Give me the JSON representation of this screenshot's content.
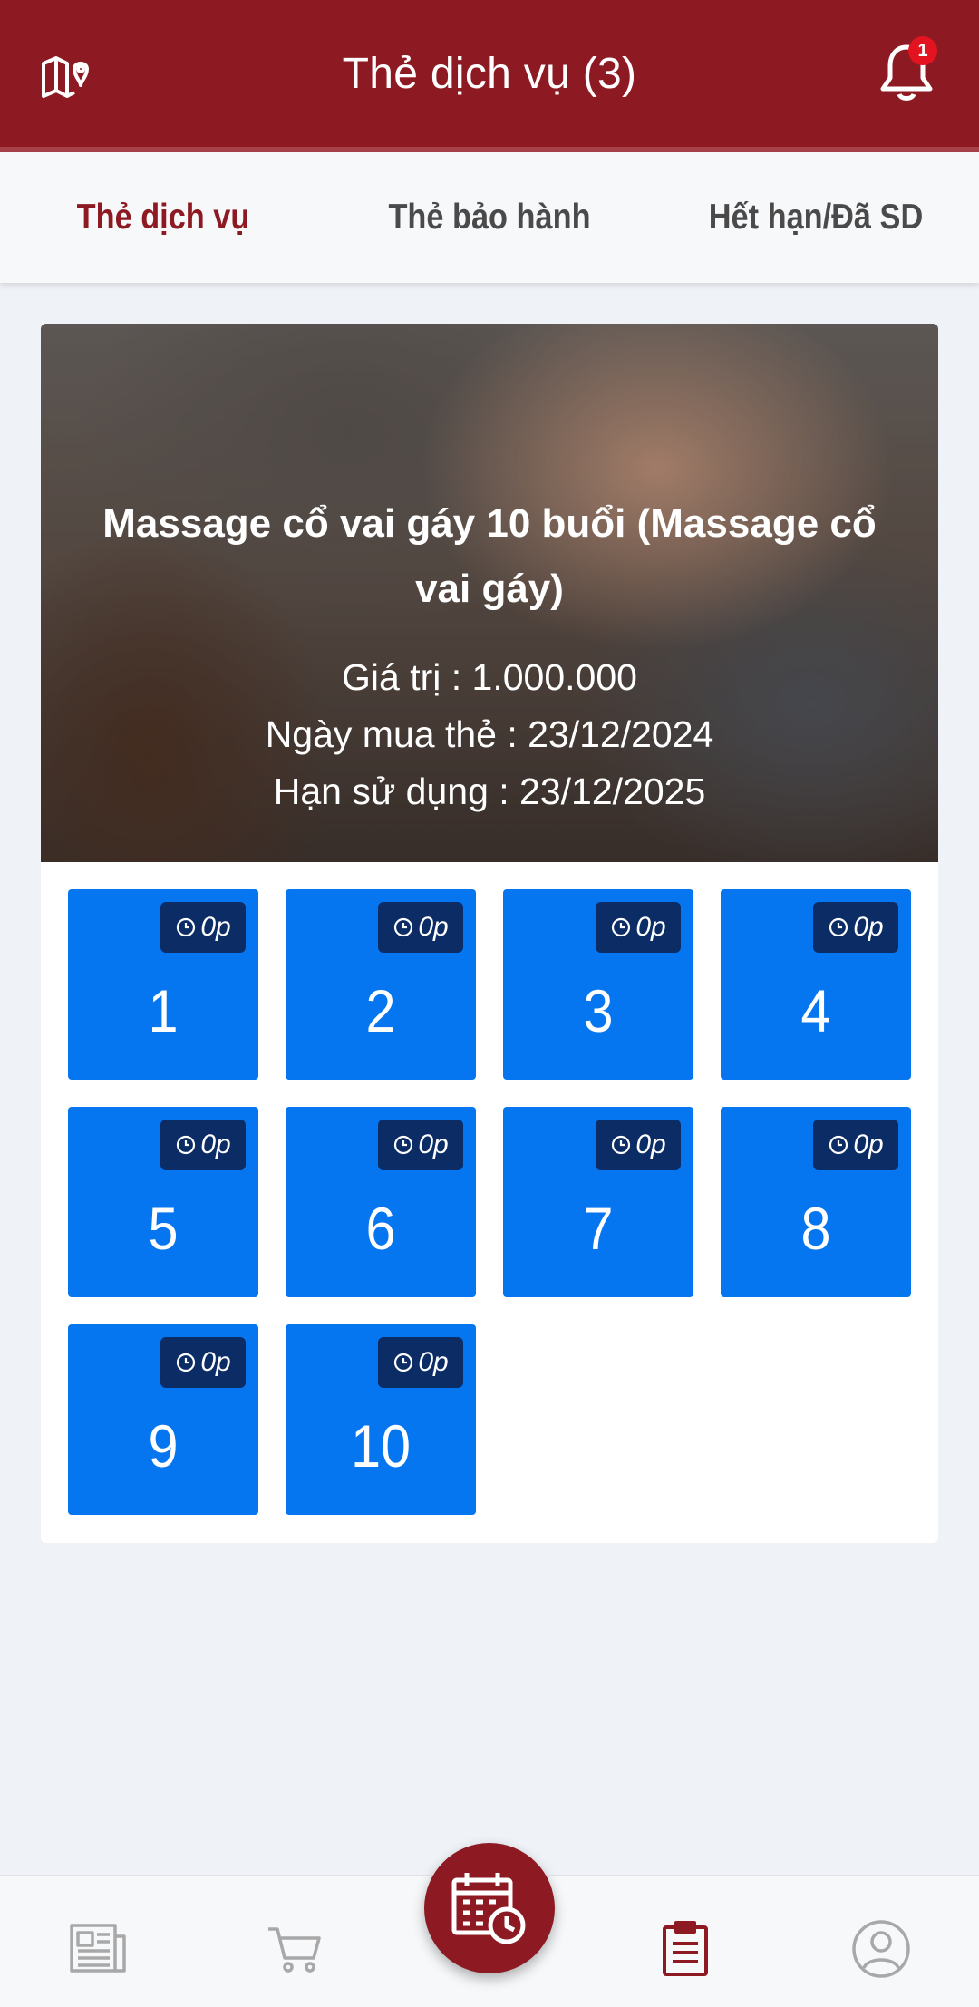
{
  "header": {
    "title": "Thẻ dịch vụ (3)",
    "notification_count": "1"
  },
  "tabs": [
    {
      "label": "Thẻ dịch vụ",
      "active": true
    },
    {
      "label": "Thẻ bảo hành",
      "active": false
    },
    {
      "label": "Hết hạn/Đã SD",
      "active": false
    }
  ],
  "card": {
    "title": "Massage cổ vai gáy 10 buổi (Massage cổ vai gáy)",
    "value_line": "Giá trị : 1.000.000",
    "purchase_line": "Ngày mua thẻ : 23/12/2024",
    "expiry_line": "Hạn sử dụng : 23/12/2025",
    "sessions": [
      {
        "number": "1",
        "time": "0p"
      },
      {
        "number": "2",
        "time": "0p"
      },
      {
        "number": "3",
        "time": "0p"
      },
      {
        "number": "4",
        "time": "0p"
      },
      {
        "number": "5",
        "time": "0p"
      },
      {
        "number": "6",
        "time": "0p"
      },
      {
        "number": "7",
        "time": "0p"
      },
      {
        "number": "8",
        "time": "0p"
      },
      {
        "number": "9",
        "time": "0p"
      },
      {
        "number": "10",
        "time": "0p"
      }
    ]
  },
  "bottom_nav": {
    "items": [
      "news-icon",
      "cart-icon",
      "calendar-clock-icon",
      "clipboard-icon",
      "profile-icon"
    ]
  },
  "colors": {
    "primary": "#8d1a22",
    "session_blue": "#0676f0",
    "badge_navy": "#0c2c66",
    "notification_red": "#e3141f"
  }
}
